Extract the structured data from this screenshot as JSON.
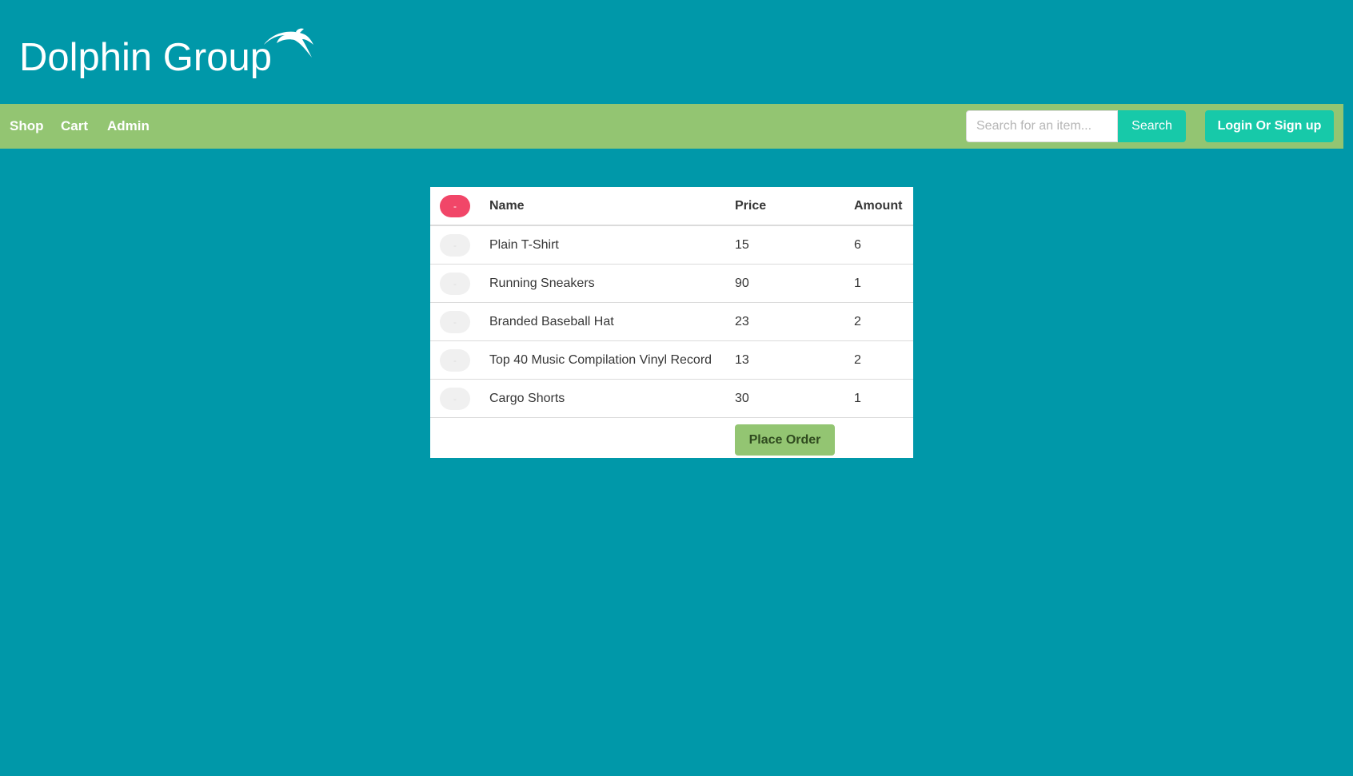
{
  "header": {
    "site_title": "Dolphin Group",
    "logo_icon": "dolphin-icon"
  },
  "nav": {
    "links": [
      {
        "label": "Shop"
      },
      {
        "label": "Cart"
      },
      {
        "label": "Admin"
      }
    ],
    "search": {
      "placeholder": "Search for an item...",
      "value": "",
      "button_label": "Search"
    },
    "login_label": "Login Or Sign up"
  },
  "cart": {
    "header": {
      "remove_all_label": "-",
      "name": "Name",
      "price": "Price",
      "amount": "Amount"
    },
    "rows": [
      {
        "remove_label": "-",
        "name": "Plain T-Shirt",
        "price": "15",
        "amount": "6"
      },
      {
        "remove_label": "-",
        "name": "Running Sneakers",
        "price": "90",
        "amount": "1"
      },
      {
        "remove_label": "-",
        "name": "Branded Baseball Hat",
        "price": "23",
        "amount": "2"
      },
      {
        "remove_label": "-",
        "name": "Top 40 Music Compilation Vinyl Record",
        "price": "13",
        "amount": "2"
      },
      {
        "remove_label": "-",
        "name": "Cargo Shorts",
        "price": "30",
        "amount": "1"
      }
    ],
    "place_order_label": "Place Order"
  },
  "colors": {
    "background": "#0098a9",
    "navbar": "#93c572",
    "accent": "#17c9a9",
    "danger": "#f14668"
  }
}
